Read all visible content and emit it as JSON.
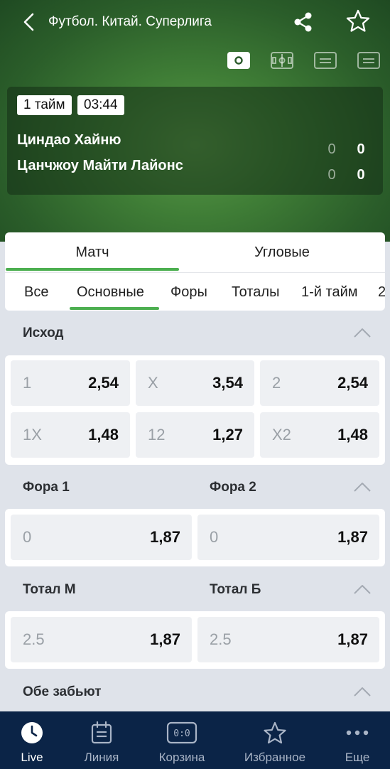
{
  "header": {
    "title": "Футбол. Китай. Суперлига",
    "back_icon": "chevron-left-icon",
    "share_icon": "share-icon",
    "favorite_icon": "star-outline-icon",
    "view_toggles": [
      "ball-view-icon",
      "field-view-icon",
      "stats-view-icon",
      "list-view-icon"
    ]
  },
  "match": {
    "period": "1 тайм",
    "time": "03:44",
    "teams": [
      {
        "name": "Циндао Хайню",
        "score_period": "0",
        "score_total": "0"
      },
      {
        "name": "Цанчжоу Майти Лайонс",
        "score_period": "0",
        "score_total": "0"
      }
    ]
  },
  "main_tabs": [
    {
      "label": "Матч",
      "active": true
    },
    {
      "label": "Угловые",
      "active": false
    }
  ],
  "sub_tabs": [
    {
      "label": "Все",
      "active": false
    },
    {
      "label": "Основные",
      "active": true
    },
    {
      "label": "Форы",
      "active": false
    },
    {
      "label": "Тоталы",
      "active": false
    },
    {
      "label": "1-й тайм",
      "active": false
    },
    {
      "label": "2",
      "active": false
    }
  ],
  "sections": {
    "outcome": {
      "title": "Исход",
      "rows": [
        [
          {
            "label": "1",
            "value": "2,54"
          },
          {
            "label": "X",
            "value": "3,54"
          },
          {
            "label": "2",
            "value": "2,54"
          }
        ],
        [
          {
            "label": "1X",
            "value": "1,48"
          },
          {
            "label": "12",
            "value": "1,27"
          },
          {
            "label": "X2",
            "value": "1,48"
          }
        ]
      ]
    },
    "handicap": {
      "title_left": "Фора 1",
      "title_right": "Фора 2",
      "cells": [
        {
          "label": "0",
          "value": "1,87"
        },
        {
          "label": "0",
          "value": "1,87"
        }
      ]
    },
    "total": {
      "title_left": "Тотал М",
      "title_right": "Тотал Б",
      "cells": [
        {
          "label": "2.5",
          "value": "1,87"
        },
        {
          "label": "2.5",
          "value": "1,87"
        }
      ]
    },
    "both_score": {
      "title": "Обе забьют"
    }
  },
  "bottom_nav": [
    {
      "label": "Live",
      "icon": "live-clock-icon",
      "active": true
    },
    {
      "label": "Линия",
      "icon": "calendar-icon",
      "active": false
    },
    {
      "label": "Корзина",
      "icon": "coupon-score-icon",
      "active": false
    },
    {
      "label": "Избранное",
      "icon": "star-icon",
      "active": false
    },
    {
      "label": "Еще",
      "icon": "more-dots-icon",
      "active": false
    }
  ],
  "colors": {
    "accent_green": "#4caf50",
    "nav_background": "#0b2447",
    "page_background": "#dfe3ea"
  }
}
